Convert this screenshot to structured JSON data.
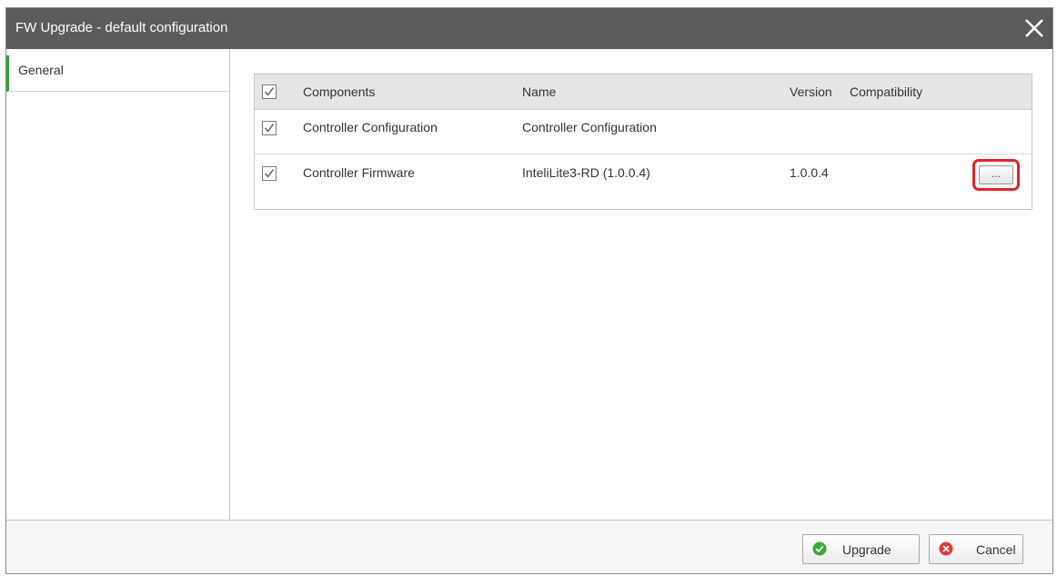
{
  "dialog": {
    "title": "FW Upgrade - default configuration"
  },
  "sidebar": {
    "tabs": [
      {
        "label": "General"
      }
    ]
  },
  "grid": {
    "columns": {
      "components": "Components",
      "name": "Name",
      "version": "Version",
      "compatibility": "Compatibility"
    },
    "rows": [
      {
        "checked": true,
        "component": "Controller Configuration",
        "name": "Controller Configuration",
        "version": "",
        "compatibility": ""
      },
      {
        "checked": true,
        "component": "Controller Firmware",
        "name": "InteliLite3-RD (1.0.0.4)",
        "version": "1.0.0.4",
        "compatibility": "",
        "more_label": "..."
      }
    ]
  },
  "footer": {
    "upgrade_label": "Upgrade",
    "cancel_label": "Cancel"
  },
  "colors": {
    "titlebar": "#5b5b5b",
    "tab_accent": "#31a03a",
    "highlight": "#e0222c",
    "ok_icon": "#3aaa35",
    "cancel_icon": "#e03a3a"
  },
  "icons": {
    "close": "close-icon",
    "check": "checkmark-icon",
    "ok": "ok-circle-icon",
    "cancel": "cancel-circle-icon"
  }
}
